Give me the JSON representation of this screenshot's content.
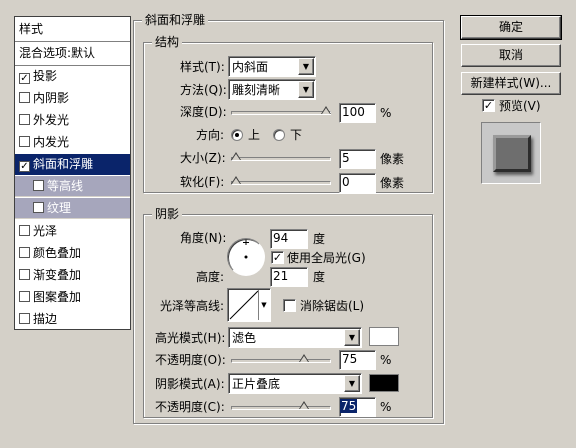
{
  "sidebar": {
    "header": "样式",
    "blend": "混合选项:默认",
    "items": [
      {
        "label": "投影",
        "checked": true
      },
      {
        "label": "内阴影",
        "checked": false
      },
      {
        "label": "外发光",
        "checked": false
      },
      {
        "label": "内发光",
        "checked": false
      },
      {
        "label": "斜面和浮雕",
        "checked": true
      },
      {
        "label": "等高线",
        "checked": false
      },
      {
        "label": "纹理",
        "checked": false
      },
      {
        "label": "光泽",
        "checked": false
      },
      {
        "label": "颜色叠加",
        "checked": false
      },
      {
        "label": "渐变叠加",
        "checked": false
      },
      {
        "label": "图案叠加",
        "checked": false
      },
      {
        "label": "描边",
        "checked": false
      }
    ]
  },
  "buttons": {
    "ok": "确定",
    "cancel": "取消",
    "new_style": "新建样式(W)...",
    "preview": "预览(V)"
  },
  "bevel": {
    "section_title": "斜面和浮雕",
    "structure_title": "结构",
    "style_label": "样式(T):",
    "style_value": "内斜面",
    "technique_label": "方法(Q):",
    "technique_value": "雕刻清晰",
    "depth_label": "深度(D):",
    "depth_value": "100",
    "depth_unit": "%",
    "depth_level": 1.0,
    "direction_label": "方向:",
    "dir_up": "上",
    "dir_down": "下",
    "size_label": "大小(Z):",
    "size_value": "5",
    "size_unit": "像素",
    "size_level": 0.0,
    "soften_label": "软化(F):",
    "soften_value": "0",
    "soften_unit": "像素",
    "soften_level": 0.0
  },
  "shading": {
    "title": "阴影",
    "angle_label": "角度(N):",
    "angle_value": "94",
    "angle_unit": "度",
    "global_light": "使用全局光(G)",
    "altitude_label": "高度:",
    "altitude_value": "21",
    "altitude_unit": "度",
    "gloss_label": "光泽等高线:",
    "antialias": "消除锯齿(L)",
    "highlight_label": "高光模式(H):",
    "highlight_mode": "滤色",
    "highlight_color": "#ffffff",
    "hl_opacity_label": "不透明度(O):",
    "hl_opacity_value": "75",
    "hl_opacity_unit": "%",
    "hl_opacity_level": 0.75,
    "shadow_label": "阴影模式(A):",
    "shadow_mode": "正片叠底",
    "shadow_color": "#000000",
    "sh_opacity_label": "不透明度(C):",
    "sh_opacity_value": "75",
    "sh_opacity_unit": "%",
    "sh_opacity_level": 0.75
  }
}
